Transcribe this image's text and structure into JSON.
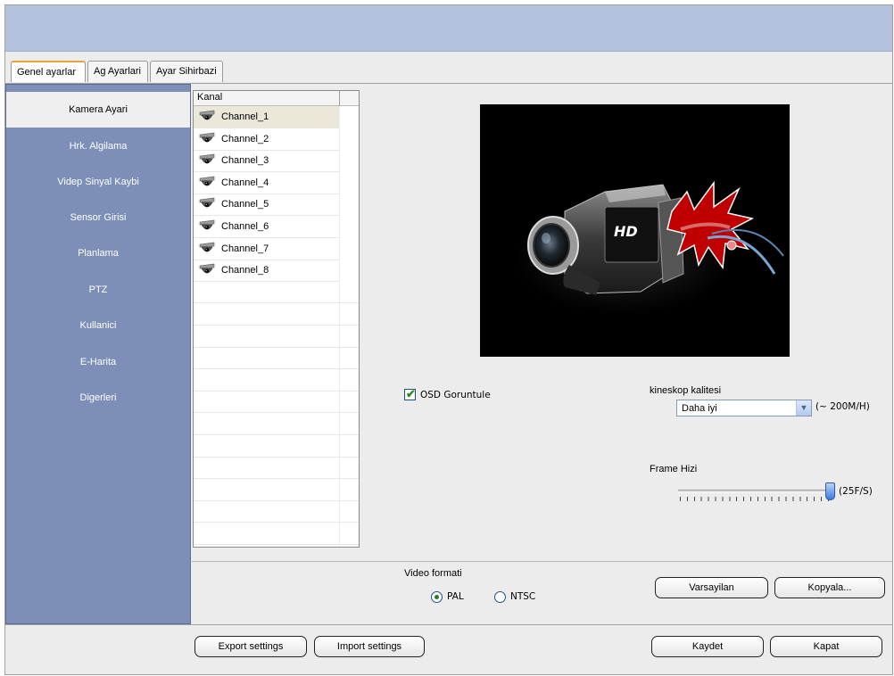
{
  "tabs": [
    {
      "label": "Genel ayarlar",
      "active": true
    },
    {
      "label": "Ag Ayarlari",
      "active": false
    },
    {
      "label": "Ayar Sihirbazi",
      "active": false
    }
  ],
  "sidebar": {
    "items": [
      {
        "label": "Kamera Ayari",
        "active": true
      },
      {
        "label": "Hrk. Algilama"
      },
      {
        "label": "Videp Sinyal Kaybi"
      },
      {
        "label": "Sensor Girisi"
      },
      {
        "label": "Planlama"
      },
      {
        "label": "PTZ"
      },
      {
        "label": "Kullanici"
      },
      {
        "label": "E-Harita"
      },
      {
        "label": "Digerleri"
      }
    ]
  },
  "channel_list": {
    "header": "Kanal",
    "channels": [
      "Channel_1",
      "Channel_2",
      "Channel_3",
      "Channel_4",
      "Channel_5",
      "Channel_6",
      "Channel_7",
      "Channel_8"
    ],
    "selected": "Channel_1",
    "icon": "dome-camera-icon"
  },
  "preview": {
    "brand_text": "HD"
  },
  "osd": {
    "label": "OSD Goruntule",
    "checked": true
  },
  "kinescope": {
    "label": "kineskop kalitesi",
    "value": "Daha iyi",
    "hint": "(~ 200M/H)"
  },
  "frame_rate": {
    "label": "Frame Hizi",
    "value_label": "(25F/S)",
    "level": 1.0
  },
  "video_format": {
    "label": "Video formati",
    "options": [
      {
        "label": "PAL",
        "selected": true
      },
      {
        "label": "NTSC",
        "selected": false
      }
    ]
  },
  "buttons": {
    "default": "Varsayilan",
    "copy": "Kopyala...",
    "export": "Export settings",
    "import": "Import settings",
    "save": "Kaydet",
    "close": "Kapat"
  },
  "colors": {
    "banner": "#b4c2de",
    "sidebar": "#7d8fb9",
    "active_tab_accent": "#e8a33a",
    "selected_row": "#ebe8da"
  }
}
